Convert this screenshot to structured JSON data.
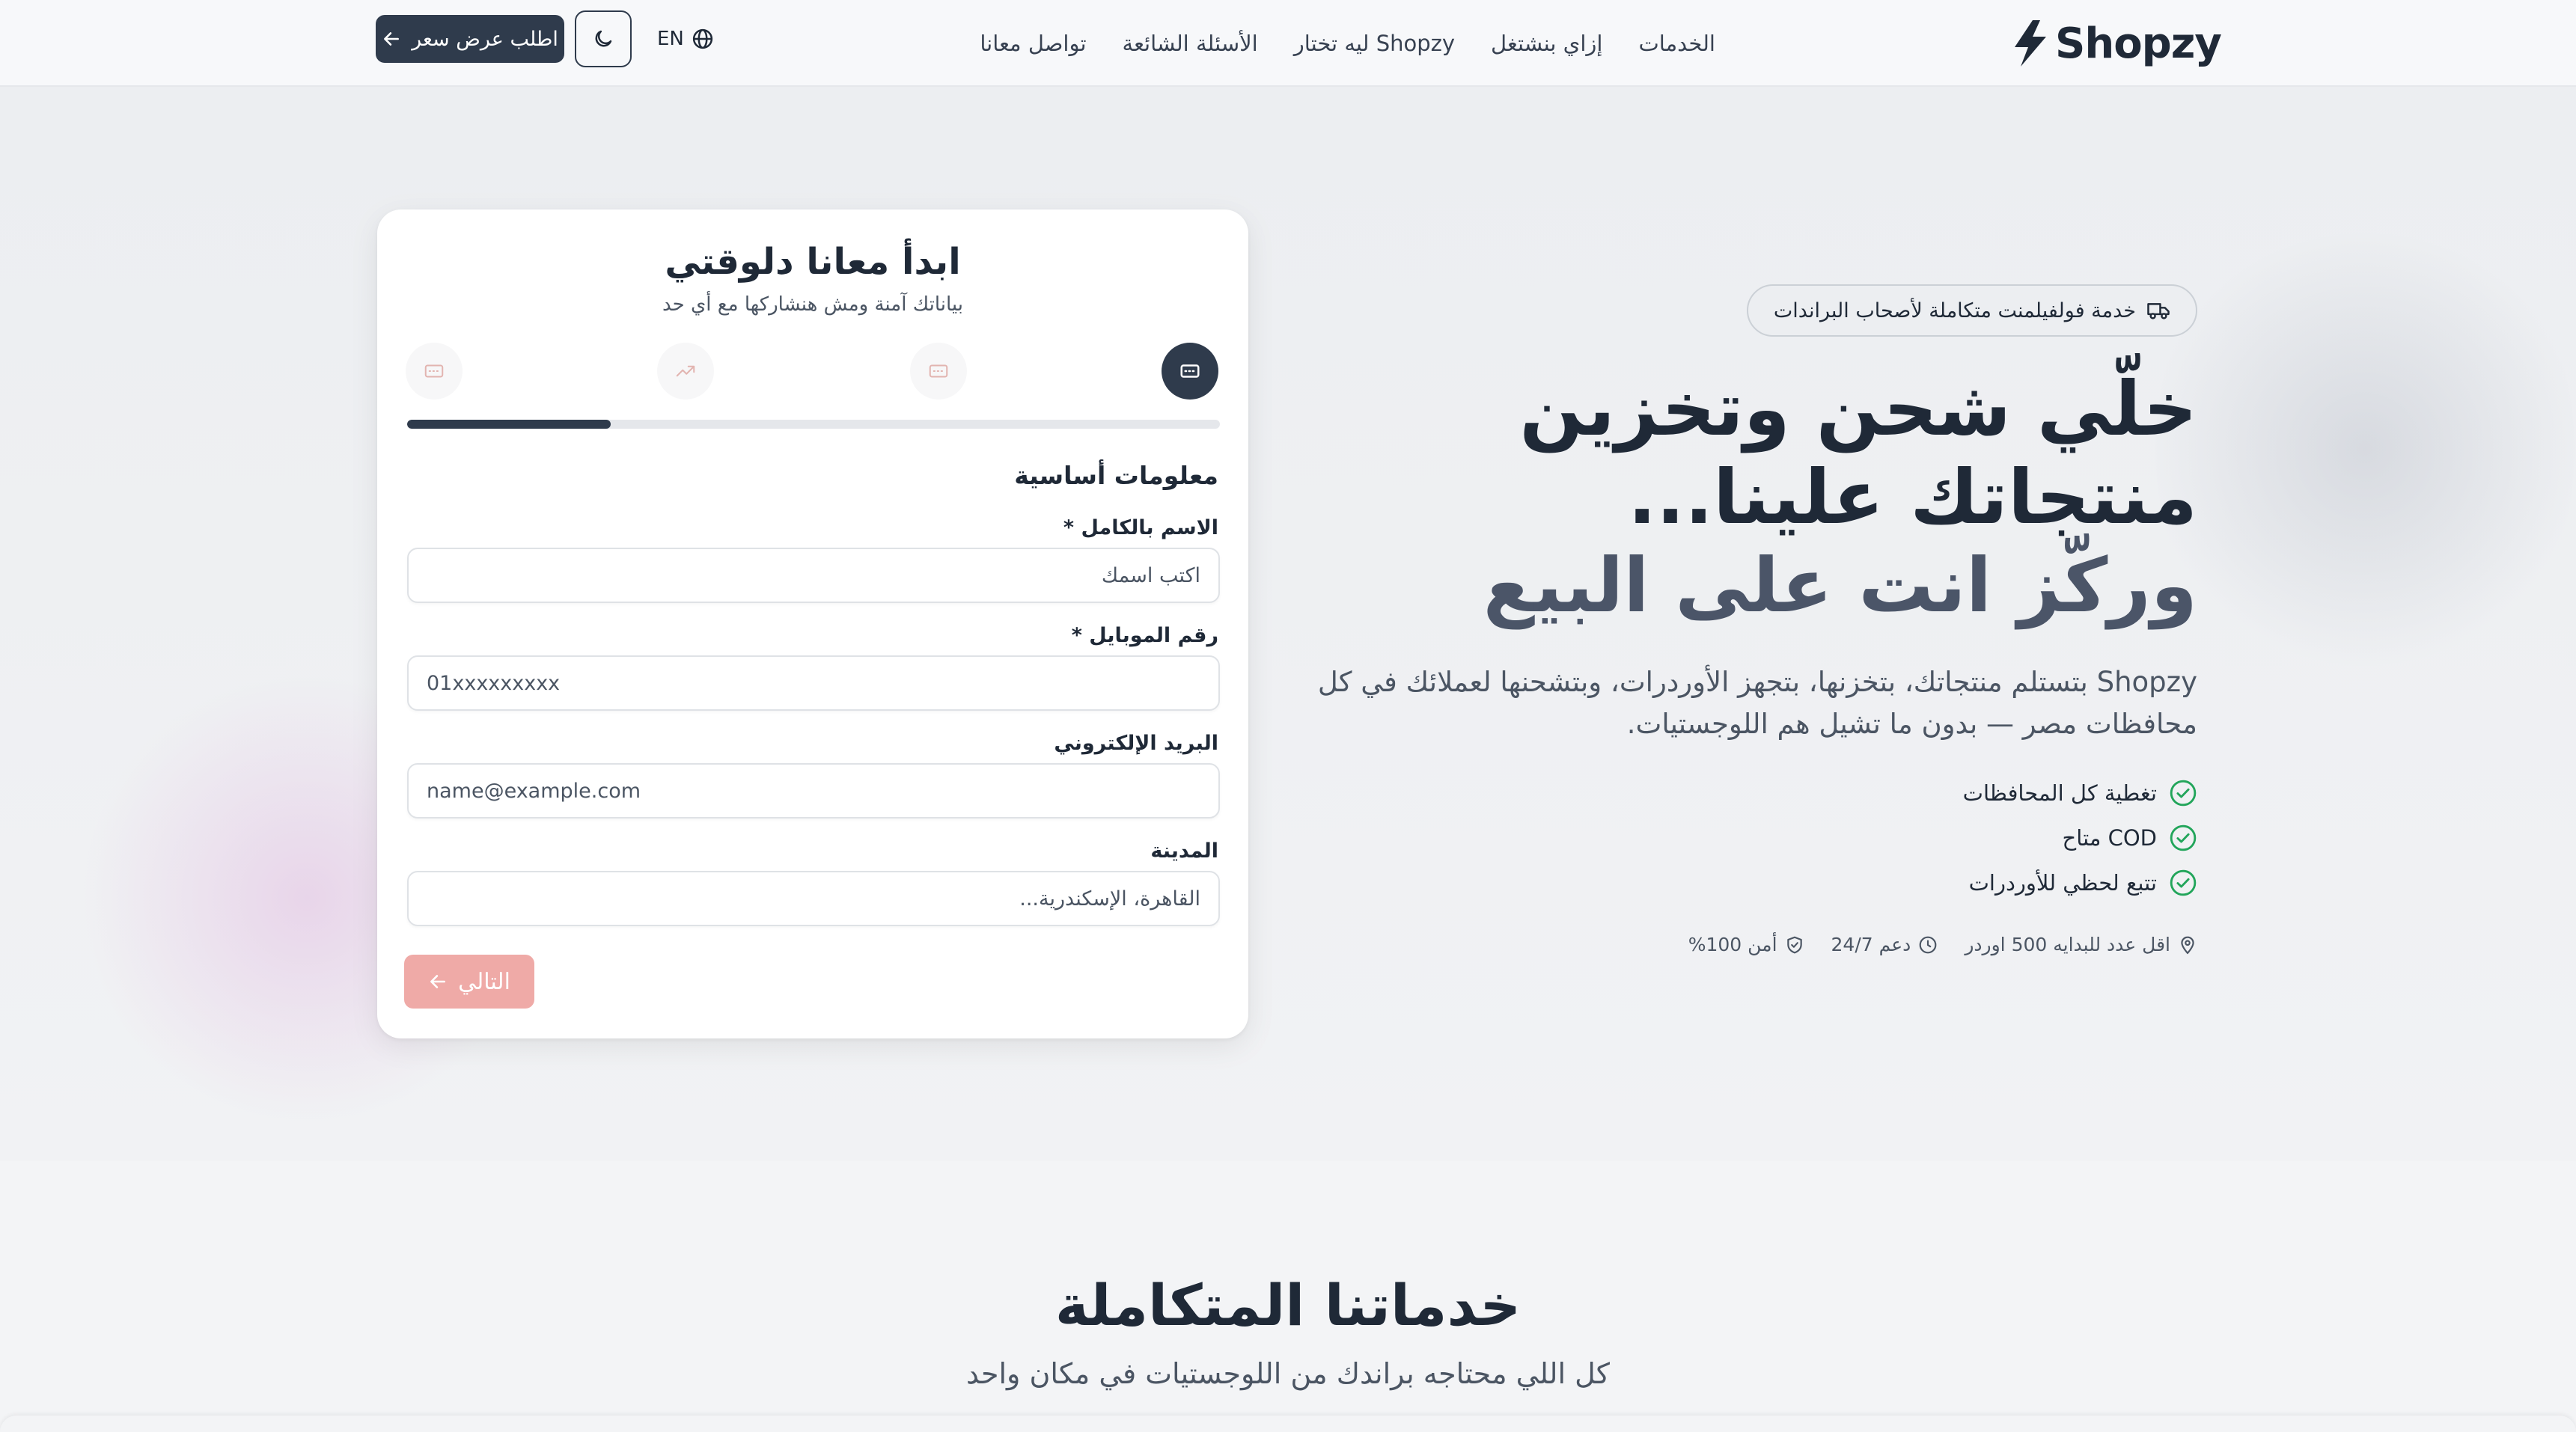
{
  "header": {
    "logo_text": "Shopzy",
    "nav": [
      {
        "label": "الخدمات"
      },
      {
        "label": "إزاي بنشتغل"
      },
      {
        "label": "ليه تختار Shopzy"
      },
      {
        "label": "الأسئلة الشائعة"
      },
      {
        "label": "تواصل معانا"
      }
    ],
    "quote_button": "اطلب عرض سعر",
    "language": "EN"
  },
  "form": {
    "title": "ابدأ معانا دلوقتي",
    "subtitle": "بياناتك آمنة ومش هنشاركها مع أي حد",
    "steps": [
      {
        "icon": "card-icon",
        "active": true
      },
      {
        "icon": "card-icon",
        "active": false
      },
      {
        "icon": "trending-up-icon",
        "active": false
      },
      {
        "icon": "card-icon",
        "active": false
      }
    ],
    "progress": 0.25,
    "section_title": "معلومات أساسية",
    "fields": {
      "name": {
        "label": "الاسم بالكامل *",
        "placeholder": "اكتب اسمك"
      },
      "phone": {
        "label": "رقم الموبايل *",
        "placeholder": "01xxxxxxxxx"
      },
      "email": {
        "label": "البريد الإلكتروني",
        "placeholder": "name@example.com"
      },
      "city": {
        "label": "المدينة",
        "placeholder": "القاهرة، الإسكندرية..."
      }
    },
    "next_button": "التالي"
  },
  "hero": {
    "badge": "خدمة فولفيلمنت متكاملة لأصحاب البراندات",
    "headline_line1": "خلّي شحن وتخزين منتجاتك علينا...",
    "headline_line2": "وركّز انت على البيع",
    "description": "Shopzy بتستلم منتجاتك، بتخزنها، بتجهز الأوردرات، وبتشحنها لعملائك في كل محافظات مصر — بدون ما تشيل هم اللوجستيات.",
    "features": [
      "تغطية كل المحافظات",
      "COD متاح",
      "تتبع لحظي للأوردرات"
    ],
    "stats": [
      {
        "icon": "map-pin-icon",
        "text": "اقل عدد للبدايه 500 اوردر"
      },
      {
        "icon": "clock-icon",
        "text": "دعم 24/7"
      },
      {
        "icon": "shield-icon",
        "text": "أمن 100%"
      }
    ]
  },
  "services": {
    "title": "خدماتنا المتكاملة",
    "subtitle": "كل اللي محتاجه براندك من اللوجستيات في مكان واحد"
  },
  "colors": {
    "primary": "#2f3b4c",
    "next_button_disabled": "#efaaa7",
    "check_green": "#22a55a",
    "background": "#f3f4f6"
  }
}
